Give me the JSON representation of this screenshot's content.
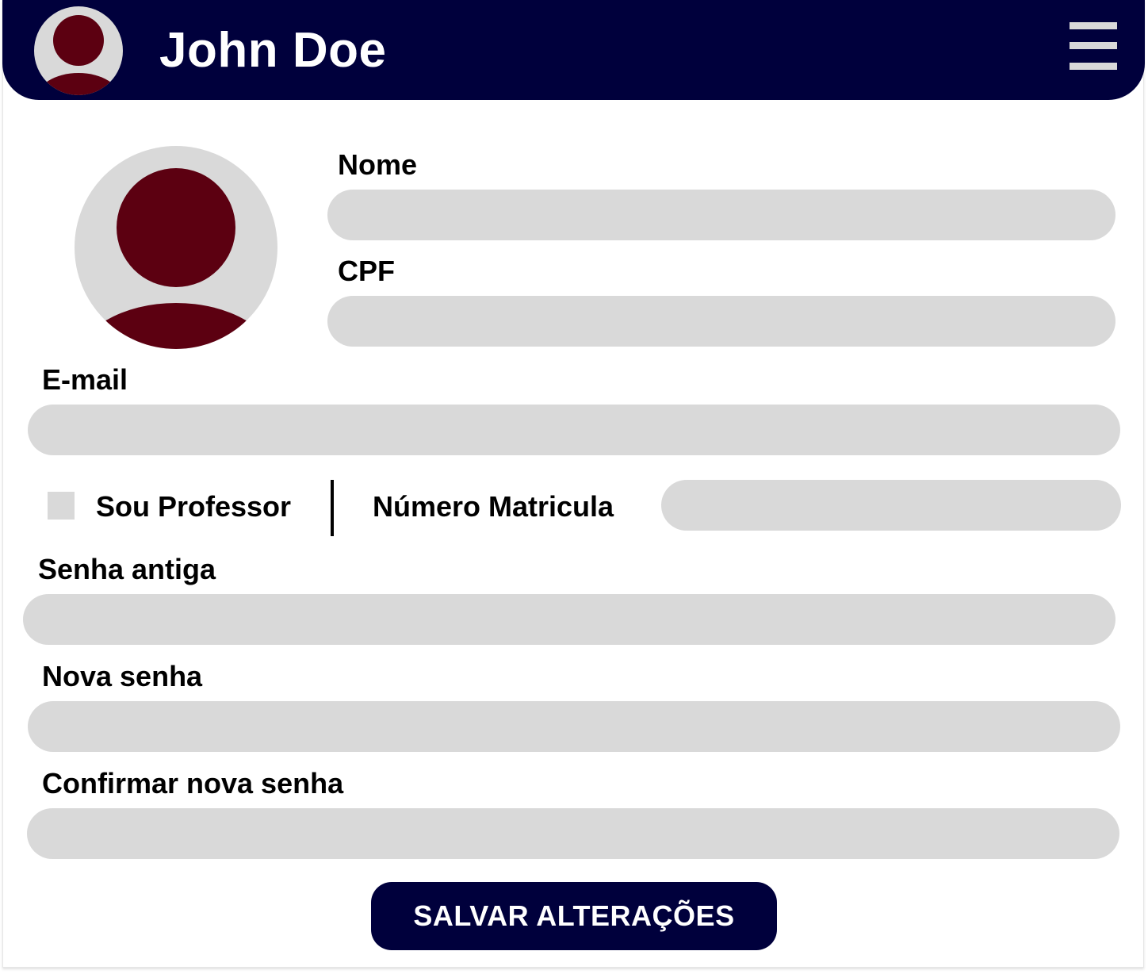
{
  "header": {
    "user_name": "John Doe",
    "avatar_icon": "user-avatar-icon",
    "menu_icon": "hamburger-menu-icon"
  },
  "profile": {
    "avatar_icon": "user-avatar-icon"
  },
  "form": {
    "name_label": "Nome",
    "name_value": "",
    "cpf_label": "CPF",
    "cpf_value": "",
    "email_label": "E-mail",
    "email_value": "",
    "professor_label": "Sou Professor",
    "professor_checked": false,
    "registration_label": "Número Matricula",
    "registration_value": "",
    "old_password_label": "Senha antiga",
    "old_password_value": "",
    "new_password_label": "Nova senha",
    "new_password_value": "",
    "confirm_password_label": "Confirmar nova senha",
    "confirm_password_value": "",
    "save_label": "SALVAR ALTERAÇÕES"
  },
  "colors": {
    "header_bg": "#00003c",
    "avatar_fg": "#5c0011",
    "avatar_bg": "#d9d9d9",
    "field_bg": "#d9d9d9",
    "button_bg": "#00003c",
    "button_text": "#ffffff"
  }
}
